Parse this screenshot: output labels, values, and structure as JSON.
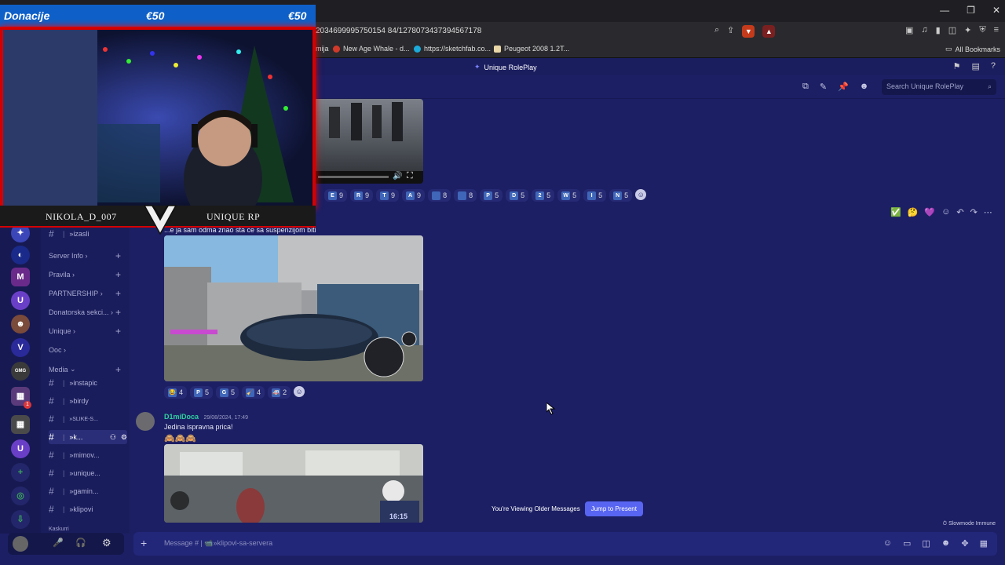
{
  "browser": {
    "url": "2034699995750154 84/1278073437394567178",
    "bookmarks": [
      {
        "label": "mija",
        "color": "#444"
      },
      {
        "label": "New Age Whale - d...",
        "color": "#d03a2a"
      },
      {
        "label": "https://sketchfab.co...",
        "color": "#1caad9"
      },
      {
        "label": "Peugeot 2008 1.2T...",
        "color": "#e9d7a8"
      }
    ],
    "all_bookmarks": "All Bookmarks"
  },
  "discord": {
    "server_name": "Unique RolePlay",
    "search_placeholder": "Search Unique RolePlay",
    "channel_categories": [
      {
        "label": "Server Info",
        "chevron": "›"
      },
      {
        "label": "Pravila",
        "chevron": "›"
      },
      {
        "label": "PARTNERSHIP",
        "chevron": "›"
      },
      {
        "label": "Donatorska sekci...",
        "chevron": "›"
      },
      {
        "label": "Unique",
        "chevron": "›"
      },
      {
        "label": "Ooc",
        "chevron": "›"
      },
      {
        "label": "Media",
        "chevron": "⌄"
      }
    ],
    "channels": [
      {
        "label": "»izasli",
        "emoji": "📹"
      },
      {
        "label": "»instapic",
        "emoji": "📷"
      },
      {
        "label": "»birdy",
        "emoji": "📷"
      },
      {
        "label": "»SLIKE-S...",
        "emoji": "📷"
      },
      {
        "label": "»k...",
        "emoji": "📹"
      },
      {
        "label": "»mimov...",
        "emoji": "😂"
      },
      {
        "label": "»unique...",
        "emoji": "📷"
      },
      {
        "label": "»gamin...",
        "emoji": "🎮"
      },
      {
        "label": "»klipovi",
        "emoji": "📹"
      }
    ],
    "bottom_category": "Kaskurri",
    "composer_placeholder": "Message # | 📹»klipovi-sa-servera",
    "slowmode": "Slowmode Immune",
    "older_messages": "You're Viewing Older Messages",
    "jump_label": "Jump to Present",
    "reactions_row1": [
      {
        "emoji": "E",
        "count": "9"
      },
      {
        "emoji": "R",
        "count": "9"
      },
      {
        "emoji": "T",
        "count": "9"
      },
      {
        "emoji": "A",
        "count": "9"
      },
      {
        "emoji": "",
        "count": "8"
      },
      {
        "emoji": "",
        "count": "8"
      },
      {
        "emoji": "P",
        "count": "5"
      },
      {
        "emoji": "D",
        "count": "5"
      },
      {
        "emoji": "2",
        "count": "5"
      },
      {
        "emoji": "W",
        "count": "5"
      },
      {
        "emoji": "I",
        "count": "5"
      },
      {
        "emoji": "N",
        "count": "5"
      }
    ],
    "message1_text": "...e ja sam odma znao sta ce sa suspenzijom biti",
    "reactions_row2": [
      {
        "emoji": "😂",
        "count": "4"
      },
      {
        "emoji": "P",
        "count": "5"
      },
      {
        "emoji": "G",
        "count": "5"
      },
      {
        "emoji": "🧹",
        "count": "4"
      },
      {
        "emoji": "🚑",
        "count": "2"
      }
    ],
    "message2": {
      "author": "D1miDoca",
      "timestamp": "29/08/2024, 17:49",
      "text": "Jedina ispravna prica!",
      "emojis": "🙈🙈🙈"
    },
    "video_timestamp": "16:15"
  },
  "overlay": {
    "donation_label": "Donacije",
    "donation_amount_1": "€50",
    "donation_amount_2": "€50",
    "streamer_name": "NIKOLA_D_007",
    "server_tag": "UNIQUE RP"
  },
  "colors": {
    "discord_bg": "#1c1f64",
    "accent": "#5865f2",
    "overlay_red": "#d40000",
    "donation_blue": "#0e60c8"
  }
}
